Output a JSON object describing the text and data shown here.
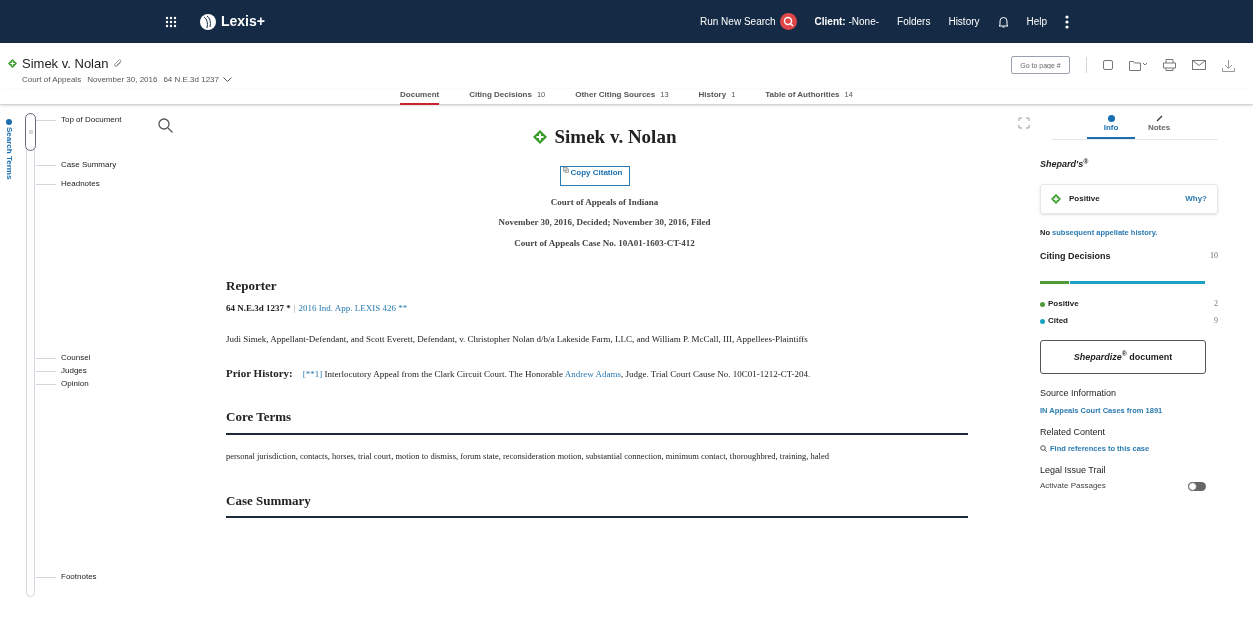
{
  "topbar": {
    "brand": "Lexis+",
    "links": [
      {
        "kind": "search",
        "label": "Run New Search"
      },
      {
        "kind": "client",
        "label": "Client:",
        "value": "-None-"
      },
      {
        "kind": "plain",
        "label": "Folders"
      },
      {
        "kind": "plain",
        "label": "History"
      },
      {
        "kind": "bell"
      },
      {
        "kind": "plain",
        "label": "Help"
      },
      {
        "kind": "more"
      }
    ]
  },
  "header": {
    "title": "Simek v. Nolan",
    "court": "Court of Appeals",
    "date": "November 30, 2016",
    "citation": "64 N.E.3d 1237",
    "goto_placeholder": "Go to page #"
  },
  "tabs": [
    {
      "label": "Document",
      "selected": true
    },
    {
      "label": "Citing Decisions",
      "count": "10",
      "selected": false
    },
    {
      "label": "Other Citing Sources",
      "count": "13",
      "selected": false
    },
    {
      "label": "History",
      "count": "1",
      "selected": false
    },
    {
      "label": "Table of Authorities",
      "count": "14",
      "selected": false
    }
  ],
  "search_terms": "Search Terms",
  "outline": [
    {
      "label": "Top of Document"
    },
    {
      "label": "Case Summary"
    },
    {
      "label": "Headnotes"
    },
    {
      "label": "Counsel"
    },
    {
      "label": "Judges"
    },
    {
      "label": "Opinion"
    },
    {
      "label": "Footnotes"
    }
  ],
  "document": {
    "title": "Simek v. Nolan",
    "copy_citation": "Copy Citation",
    "court": "Court of Appeals of Indiana",
    "decided": "November 30, 2016, Decided; November 30, 2016, Filed",
    "case_no": "Court of Appeals Case No. 10A01-1603-CT-412",
    "reporter_heading": "Reporter",
    "reporter_cite": "64 N.E.3d 1237 *",
    "reporter_separator": "|",
    "reporter_link": "2016 Ind. App. LEXIS 426 **",
    "parties": "Judi Simek, Appellant-Defendant, and Scott Everett, Defendant, v. Christopher Nolan d/b/a Lakeside Farm, LLC, and William P. McCall, III, Appellees-Plaintiffs",
    "prior_history_label": "Prior History:",
    "prior_history_page": "[**1]",
    "prior_history_before": "Interlocutory Appeal from the Clark Circuit Court. The Honorable",
    "prior_history_judge": "Andrew Adams",
    "prior_history_after": ", Judge. Trial Court Cause No. 10C01-1212-CT-204.",
    "core_terms_heading": "Core Terms",
    "core_terms": "personal jurisdiction, contacts, horses, trial court, motion to dismiss, forum state, reconsideration motion, substantial connection, minimum contact, thoroughbred, training, haled",
    "case_summary_heading": "Case Summary"
  },
  "panel": {
    "tabs": [
      {
        "label": "Info",
        "selected": true
      },
      {
        "label": "Notes",
        "selected": false
      }
    ],
    "shepards": "Shepard's$^{®}$",
    "status": "Positive",
    "why": "Why?",
    "no_history_prefix": "No",
    "no_history_link": "subsequent appellate history.",
    "citing_title": "Citing Decisions",
    "citing_total": "10",
    "level": 0.18,
    "legend": [
      {
        "label": "Positive",
        "count": "2",
        "color": "#4e9a3a"
      },
      {
        "label": "Cited",
        "count": "9",
        "color": "#1aa3c4"
      }
    ],
    "shepardize": "*Shepardize$^{®}$* document",
    "source_title": "Source Information",
    "source_link": "IN Appeals Court Cases from 1891",
    "related_title": "Related Content",
    "related_link": "Find references to this case",
    "trail_title": "Legal Issue Trail",
    "trail_label": "Activate Passages",
    "trail_on": false
  }
}
